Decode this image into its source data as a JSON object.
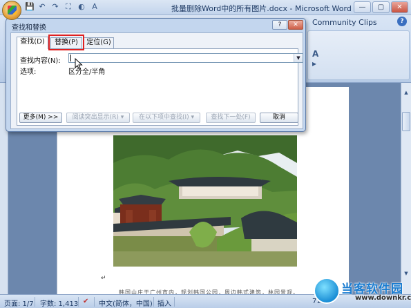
{
  "window": {
    "title": "批量删除Word中的所有图片.docx - Microsoft Word",
    "min": "—",
    "max": "▢",
    "close": "✕"
  },
  "qat": [
    "💾",
    "↶",
    "↷",
    "⛶",
    "◐",
    "A"
  ],
  "ribbon": {
    "community_clips": "Community Clips",
    "help": "?"
  },
  "dialog": {
    "title": "查找和替换",
    "help": "?",
    "close": "✕",
    "tabs": [
      {
        "label": "查找(D)",
        "active": true
      },
      {
        "label": "替换(P)",
        "active": false,
        "highlighted": true
      },
      {
        "label": "定位(G)",
        "active": false
      }
    ],
    "find_label": "查找内容(N):",
    "find_value": "",
    "options_label": "选项:",
    "options_value": "区分全/半角",
    "buttons": {
      "more": "更多(M) >>",
      "reading_highlight": "阅读突出显示(R) ▾",
      "find_in": "在以下项中查找(I) ▾",
      "find_next": "查找下一处(F)",
      "cancel": "取消"
    }
  },
  "status": {
    "page": "页面: 1/7",
    "words": "字数: 1,413",
    "language": "中文(简体，中国)",
    "mode": "插入",
    "zoom": "71%"
  },
  "document": {
    "paragraph_mark": "↵",
    "body_text": "韩国山庄于广州市内，规划韩国公园，周边韩式建筑，林园景观。"
  },
  "watermark": {
    "name": "当客软件园",
    "url": "www.downkr.com"
  },
  "colors": {
    "highlight_border": "#e02020",
    "accent": "#1a7cd0"
  }
}
